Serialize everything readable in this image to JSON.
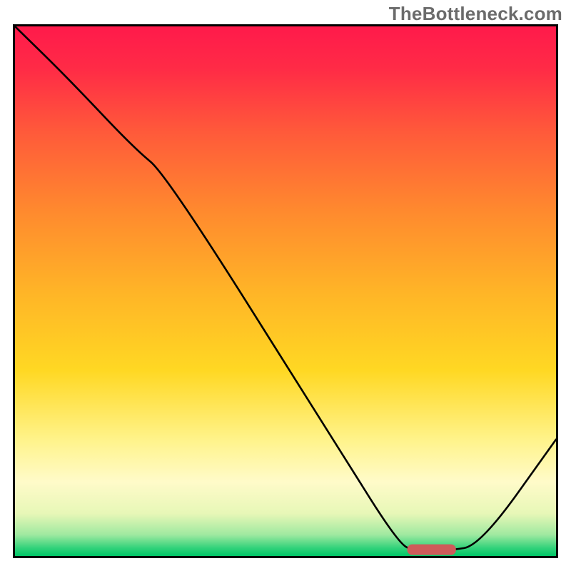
{
  "watermark": "TheBottleneck.com",
  "chart_data": {
    "type": "line",
    "title": "",
    "xlabel": "",
    "ylabel": "",
    "xlim": [
      0,
      100
    ],
    "ylim": [
      0,
      100
    ],
    "grid": false,
    "legend": false,
    "annotations": [],
    "background": {
      "type": "vertical-gradient",
      "stops": [
        {
          "offset": 0.0,
          "color": "#ff1a4b"
        },
        {
          "offset": 0.08,
          "color": "#ff2b46"
        },
        {
          "offset": 0.2,
          "color": "#ff5a3a"
        },
        {
          "offset": 0.35,
          "color": "#ff8a2e"
        },
        {
          "offset": 0.5,
          "color": "#ffb427"
        },
        {
          "offset": 0.65,
          "color": "#ffd823"
        },
        {
          "offset": 0.78,
          "color": "#fff38a"
        },
        {
          "offset": 0.86,
          "color": "#fffbc9"
        },
        {
          "offset": 0.92,
          "color": "#e7f7b7"
        },
        {
          "offset": 0.96,
          "color": "#9fe9a0"
        },
        {
          "offset": 0.985,
          "color": "#31d27a"
        },
        {
          "offset": 1.0,
          "color": "#00c667"
        }
      ]
    },
    "series": [
      {
        "name": "bottleneck-curve",
        "color": "#000000",
        "x": [
          0,
          10,
          22,
          28,
          60,
          71,
          74,
          80,
          86,
          100
        ],
        "y": [
          100,
          90,
          77,
          72,
          20,
          2.2,
          1.0,
          1.0,
          2.0,
          22
        ]
      }
    ],
    "marker": {
      "name": "optimal-range",
      "shape": "rounded-bar",
      "color": "#cf5a5a",
      "x_center": 77,
      "y_center": 1.2,
      "width": 9,
      "height": 2
    }
  }
}
